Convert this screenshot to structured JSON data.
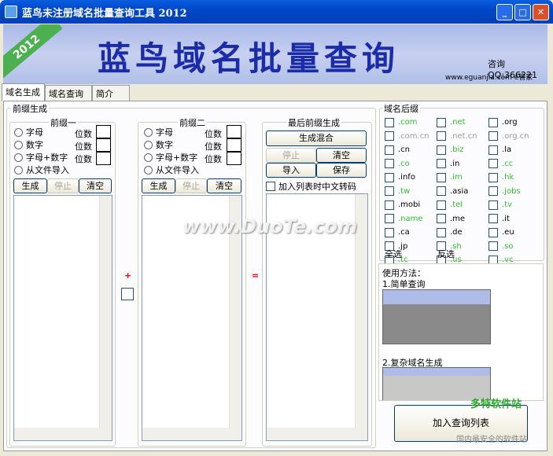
{
  "window": {
    "title": "蓝鸟未注册域名批量查询工具  2012",
    "minimize": "_",
    "maximize": "□",
    "close": "✕"
  },
  "banner": {
    "year": "2012",
    "title": "蓝鸟域名批量查询",
    "qq": "咨询QQ:366221",
    "site": "www.eguanjia.com  e管家"
  },
  "tabs": [
    "域名生成",
    "域名查询",
    "简介"
  ],
  "prefix_group": {
    "label": "前缀生成"
  },
  "prefix1": {
    "label": "前缀一",
    "options": [
      "字母",
      "数字",
      "字母+数字",
      "从文件导入"
    ],
    "digits_label": "位数",
    "buttons": [
      "生成",
      "停止",
      "清空"
    ]
  },
  "prefix2": {
    "label": "前缀二",
    "options": [
      "字母",
      "数字",
      "字母+数字",
      "从文件导入"
    ],
    "digits_label": "位数",
    "buttons": [
      "生成",
      "停止",
      "清空"
    ]
  },
  "plus": "+",
  "equals": "=",
  "final": {
    "label": "最后前缀生成",
    "mix": "生成混合",
    "stop": "停止",
    "clear": "清空",
    "import": "导入",
    "save": "保存",
    "convert": "加入列表时中文转码"
  },
  "suffix_group": {
    "label": "域名后缀"
  },
  "suffixes": [
    [
      ".com",
      "green"
    ],
    [
      ".net",
      "green"
    ],
    [
      ".org",
      "black"
    ],
    [
      ".com.cn",
      "gray"
    ],
    [
      ".net.cn",
      "gray"
    ],
    [
      ".org.cn",
      "gray"
    ],
    [
      ".cn",
      "black"
    ],
    [
      ".biz",
      "green"
    ],
    [
      ".la",
      "black"
    ],
    [
      ".co",
      "green"
    ],
    [
      ".in",
      "black"
    ],
    [
      ".cc",
      "green"
    ],
    [
      ".info",
      "black"
    ],
    [
      ".im",
      "green"
    ],
    [
      ".hk",
      "green"
    ],
    [
      ".tw",
      "green"
    ],
    [
      ".asia",
      "black"
    ],
    [
      ".jobs",
      "green"
    ],
    [
      ".mobi",
      "black"
    ],
    [
      ".tel",
      "green"
    ],
    [
      ".tv",
      "green"
    ],
    [
      ".name",
      "green"
    ],
    [
      ".me",
      "black"
    ],
    [
      ".it",
      "black"
    ],
    [
      ".ca",
      "black"
    ],
    [
      ".de",
      "black"
    ],
    [
      ".eu",
      "black"
    ],
    [
      ".jp",
      "black"
    ],
    [
      ".sh",
      "green"
    ],
    [
      ".so",
      "green"
    ],
    [
      ".tc",
      "green"
    ],
    [
      ".us",
      "green"
    ],
    [
      ".vc",
      "green"
    ]
  ],
  "select_all": "全选",
  "invert": "反选",
  "usage": {
    "title": "使用方法：",
    "step1": "1.简单查询",
    "step2": "2.复杂域名生成"
  },
  "add_to_query": "加入查询列表",
  "watermarks": {
    "center": "www.DuoTe.com",
    "corner": "多特软件站",
    "corner_sub": "国内最安全的软件站"
  },
  "colors": {
    "title_bar": "#0050D8",
    "banner_text": "#1a2ca8",
    "green_suffix": "#2fbf2f"
  }
}
